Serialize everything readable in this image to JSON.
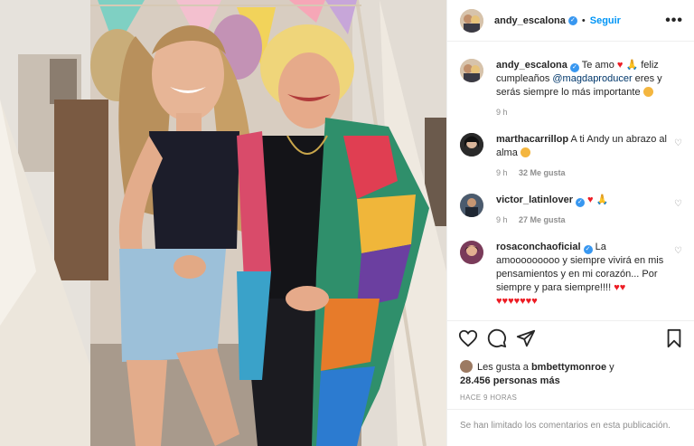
{
  "post": {
    "username": "andy_escalona",
    "dot": "•",
    "follow_label": "Seguir",
    "more_label": "•••"
  },
  "caption": {
    "username": "andy_escalona",
    "text_1": "Te amo",
    "text_2": "feliz cumpleaños",
    "mention": "@magdaproducer",
    "text_3": "eres y serás siempre lo más importante",
    "time": "9 h"
  },
  "comments": [
    {
      "username": "marthacarrillop",
      "text": "A ti Andy un abrazo al alma",
      "time": "9 h",
      "likes": "32 Me gusta"
    },
    {
      "username": "victor_latinlover",
      "text": "",
      "time": "9 h",
      "likes": "27 Me gusta"
    },
    {
      "username": "rosaconchaoficial",
      "text": "La amooooooooo y siempre vivirá en mis pensamientos y en mi corazón... Por siempre y para siempre!!!!"
    }
  ],
  "likes": {
    "prefix": "Les gusta a",
    "user": "bmbettymonroe",
    "mid": "y",
    "count": "28.456 personas más"
  },
  "timestamp": "HACE 9 HORAS",
  "comments_disabled": "Se han limitado los comentarios en esta publicación.",
  "icons": [
    "heart-icon",
    "comment-icon",
    "share-icon",
    "bookmark-icon",
    "verified-icon",
    "more-icon"
  ],
  "colors": {
    "link": "#0095f6",
    "mention": "#00376b",
    "verified": "#3897f0",
    "muted": "#8e8e8e",
    "heart": "#ed1c24"
  }
}
